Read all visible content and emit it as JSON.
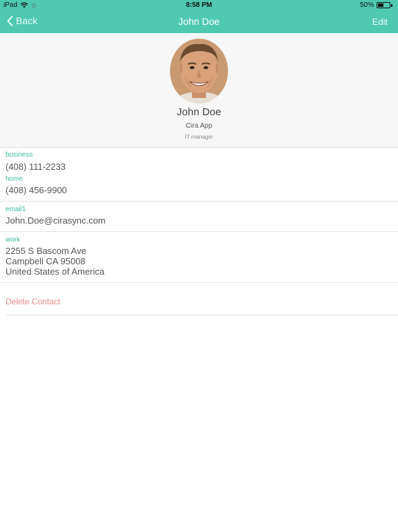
{
  "status": {
    "device": "iPad",
    "time": "8:58 PM",
    "battery": "50%",
    "battery_level": 0.5
  },
  "nav": {
    "back_label": "Back",
    "title": "John Doe",
    "edit_label": "Edit"
  },
  "profile": {
    "name": "John Doe",
    "company": "Cira App",
    "job_title": "IT manager"
  },
  "phones": [
    {
      "label": "business",
      "value": "(408) 111-2233"
    },
    {
      "label": "home",
      "value": "(408) 456-9900"
    }
  ],
  "emails": [
    {
      "label": "email1",
      "value": "John.Doe@cirasync.com"
    }
  ],
  "addresses": [
    {
      "label": "work",
      "line1": "2255 S Bascom Ave",
      "line2": "Campbell CA 95008",
      "line3": "United States of America"
    }
  ],
  "actions": {
    "delete_label": "Delete Contact"
  },
  "colors": {
    "accent": "#4fc9b0",
    "label": "#3fb9a0",
    "danger": "#e98a8a"
  }
}
